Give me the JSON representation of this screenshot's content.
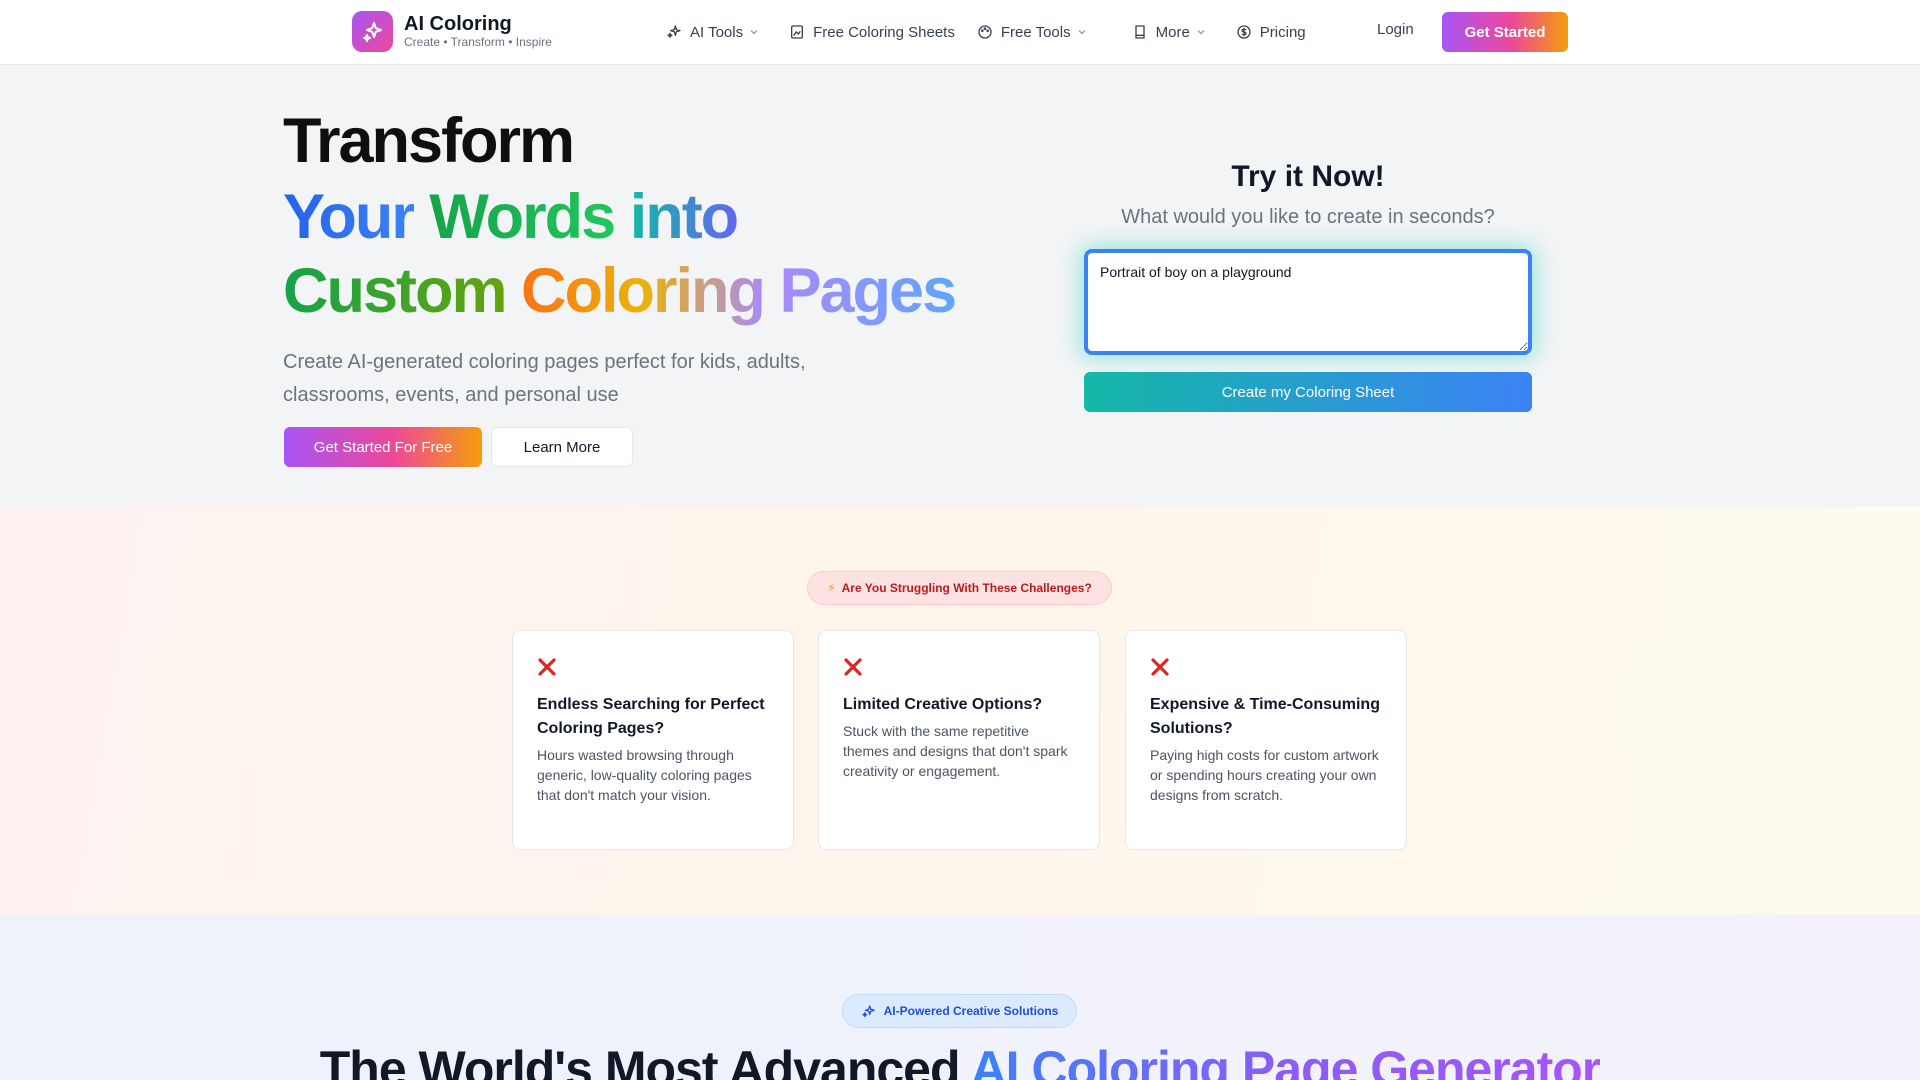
{
  "nav": {
    "brand_title": "AI Coloring",
    "brand_tagline": "Create • Transform • Inspire",
    "links": [
      {
        "label": "AI Tools",
        "icon": "sparkles-icon",
        "dropdown": true
      },
      {
        "label": "Free Coloring Sheets",
        "icon": "image-icon",
        "dropdown": false
      },
      {
        "label": "Free Tools",
        "icon": "palette-icon",
        "dropdown": true
      },
      {
        "label": "More",
        "icon": "book-icon",
        "dropdown": true
      },
      {
        "label": "Pricing",
        "icon": "dollar-circle-icon",
        "dropdown": false
      }
    ],
    "login_label": "Login",
    "cta_label": "Get Started"
  },
  "hero": {
    "line1": "Transform",
    "line2": [
      "Your",
      "Words",
      "into"
    ],
    "line3": [
      "Custom",
      "Coloring",
      "Pages"
    ],
    "subtitle": "Create AI-generated coloring pages perfect for kids, adults, classrooms, events, and personal use",
    "primary_button": "Get Started For Free",
    "secondary_button": "Learn More"
  },
  "try_it": {
    "title": "Try it Now!",
    "subtitle": "What would you like to create in seconds?",
    "prompt_value": "Portrait of boy on a playground",
    "button_label": "Create my Coloring Sheet"
  },
  "challenges": {
    "badge": "Are You Struggling With These Challenges?",
    "cards": [
      {
        "title": "Endless Searching for Perfect Coloring Pages?",
        "text": "Hours wasted browsing through generic, low-quality coloring pages that don't match your vision."
      },
      {
        "title": "Limited Creative Options?",
        "text": "Stuck with the same repetitive themes and designs that don't spark creativity or engagement."
      },
      {
        "title": "Expensive & Time-Consuming Solutions?",
        "text": "Paying high costs for custom artwork or spending hours creating your own designs from scratch."
      }
    ]
  },
  "solutions": {
    "badge": "AI-Powered Creative Solutions",
    "heading_plain": "The World's Most Advanced",
    "heading_highlight": "AI Coloring Page Generator"
  },
  "colors": {
    "accent_purple": "#a855f7",
    "accent_pink": "#ec4899",
    "accent_orange": "#f59e0b",
    "accent_teal": "#14b8a6",
    "accent_blue": "#3b82f6",
    "error_red": "#dc2626"
  }
}
